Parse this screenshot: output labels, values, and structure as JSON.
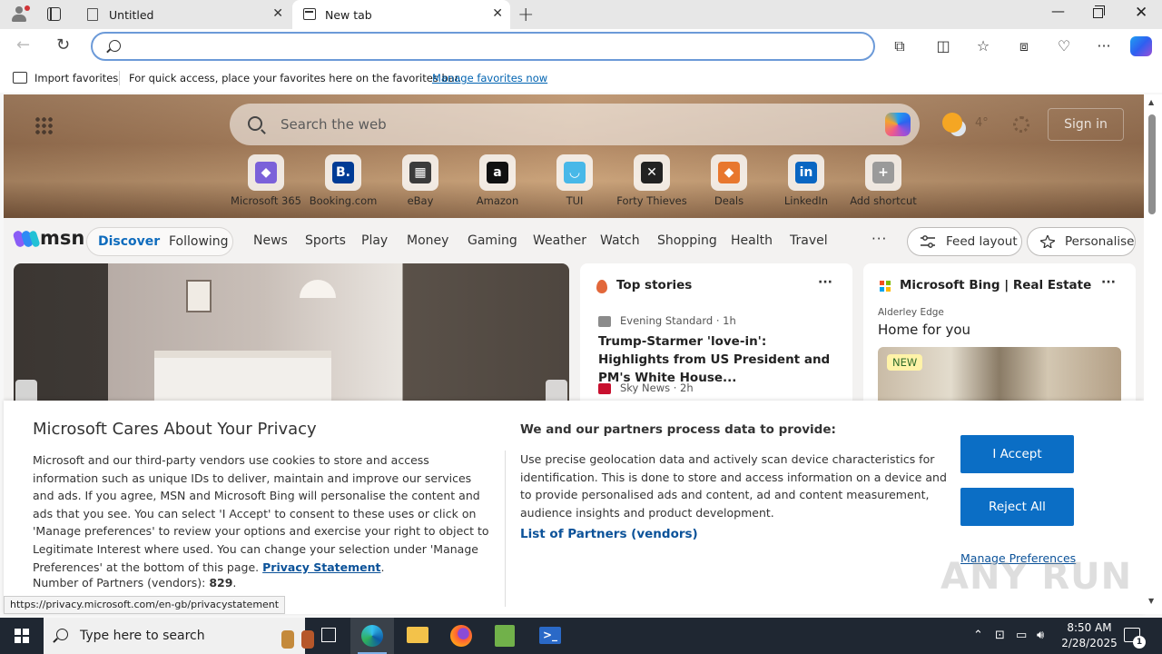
{
  "browser": {
    "tabs": [
      {
        "title": "Untitled",
        "close": "✕"
      },
      {
        "title": "New tab",
        "close": "✕"
      }
    ],
    "new_tab": "+",
    "window": {
      "minimize": "—",
      "close": "✕"
    },
    "address_placeholder": "",
    "favorites_bar": {
      "import_label": "Import favorites",
      "message": "For quick access, place your favorites here on the favorites bar.",
      "manage_link": "Manage favorites now"
    },
    "toolbar_icons": [
      "extensions-icon",
      "split-screen-icon",
      "favorites-icon",
      "collections-icon",
      "performance-icon",
      "more-icon",
      "copilot-icon"
    ]
  },
  "msn": {
    "search_placeholder": "Search the web",
    "weather_temp": "4°",
    "sign_in": "Sign in",
    "shortcuts": [
      {
        "label": "Microsoft 365",
        "glyph": "◆",
        "color": "#7b61d9"
      },
      {
        "label": "Booking.com",
        "glyph": "B.",
        "color": "#003b95"
      },
      {
        "label": "eBay",
        "glyph": "▦",
        "color": "#3b3b3b"
      },
      {
        "label": "Amazon",
        "glyph": "a",
        "color": "#111111"
      },
      {
        "label": "TUI",
        "glyph": "◡",
        "color": "#48b8e8"
      },
      {
        "label": "Forty Thieves",
        "glyph": "✕",
        "color": "#222222"
      },
      {
        "label": "Deals",
        "glyph": "◆",
        "color": "#e8772e"
      },
      {
        "label": "LinkedIn",
        "glyph": "in",
        "color": "#0a66c2"
      },
      {
        "label": "Add shortcut",
        "glyph": "+",
        "color": "#9a9a9a"
      }
    ],
    "logo_text": "msn",
    "tabs": {
      "discover": "Discover",
      "following": "Following"
    },
    "categories": [
      "News",
      "Sports",
      "Play",
      "Money",
      "Gaming",
      "Weather",
      "Watch",
      "Shopping",
      "Health",
      "Travel"
    ],
    "more": "···",
    "feed_layout": "Feed layout",
    "personalise": "Personalise",
    "top_stories": {
      "heading": "Top stories",
      "dots": "···",
      "source1": "Evening Standard · 1h",
      "headline": "Trump-Starmer 'love-in': Highlights from US President and PM's White House...",
      "source2": "Sky News · 2h"
    },
    "bing_card": {
      "heading": "Microsoft Bing | Real Estate",
      "dots": "···",
      "location": "Alderley Edge",
      "title": "Home for you",
      "badge": "NEW"
    }
  },
  "privacy": {
    "title": "Microsoft Cares About Your Privacy",
    "body": "Microsoft and our third-party vendors use cookies to store and access information such as unique IDs to deliver, maintain and improve our services and ads. If you agree, MSN and Microsoft Bing will personalise the content and ads that you see. You can select 'I Accept' to consent to these uses or click on 'Manage preferences' to review your options and exercise your right to object to Legitimate Interest where used.  You can change your selection under 'Manage Preferences' at the bottom of this page.",
    "privacy_link": "Privacy Statement",
    "partners_label": "Number of Partners (vendors):",
    "partners_count": "829",
    "right_title": "We and our partners process data to provide:",
    "right_body": "Use precise geolocation data and actively scan device characteristics for identification. This is done to store and access information on a device and to provide personalised ads and content, ad and content measurement, audience insights and product development.",
    "partners_link": "List of Partners (vendors)",
    "accept": "I Accept",
    "reject": "Reject All",
    "manage": "Manage Preferences"
  },
  "status_url": "https://privacy.microsoft.com/en-gb/privacystatement",
  "watermark": "ANY RUN",
  "taskbar": {
    "search_placeholder": "Type here to search",
    "time": "8:50 AM",
    "date": "2/28/2025",
    "notifications": "1"
  }
}
